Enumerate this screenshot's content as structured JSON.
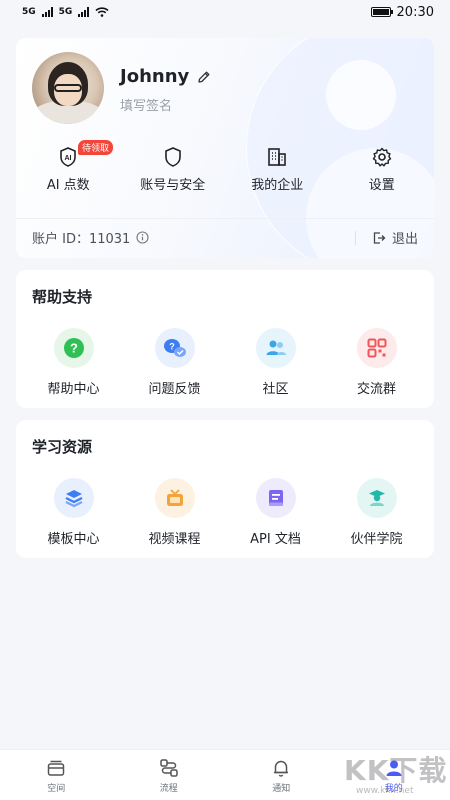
{
  "status": {
    "time": "20:30",
    "signal_left": "5G",
    "signal_right": "5G"
  },
  "profile": {
    "name": "Johnny",
    "signature_placeholder": "填写签名",
    "quick": [
      {
        "label": "AI 点数",
        "icon": "ai-shield-icon",
        "badge": "待领取"
      },
      {
        "label": "账号与安全",
        "icon": "shield-icon"
      },
      {
        "label": "我的企业",
        "icon": "building-icon"
      },
      {
        "label": "设置",
        "icon": "gear-icon"
      }
    ],
    "account_id": "账户 ID：11031",
    "logout": "退出"
  },
  "help": {
    "title": "帮助支持",
    "items": [
      {
        "label": "帮助中心",
        "icon": "question-icon",
        "color": "#2fbf54",
        "bg": "#e6f7ea"
      },
      {
        "label": "问题反馈",
        "icon": "feedback-icon",
        "color": "#3c7df4",
        "bg": "#e8f0fe"
      },
      {
        "label": "社区",
        "icon": "community-icon",
        "color": "#3aa6ea",
        "bg": "#e6f4fc"
      },
      {
        "label": "交流群",
        "icon": "qr-code-icon",
        "color": "#f0555a",
        "bg": "#fdeaea"
      }
    ]
  },
  "learn": {
    "title": "学习资源",
    "items": [
      {
        "label": "模板中心",
        "icon": "layers-icon",
        "color": "#3c7df4",
        "bg": "#e8f0fe"
      },
      {
        "label": "视频课程",
        "icon": "tv-icon",
        "color": "#f2a33a",
        "bg": "#fdf1e2"
      },
      {
        "label": "API 文档",
        "icon": "book-icon",
        "color": "#7b67f0",
        "bg": "#eeebfd"
      },
      {
        "label": "伙伴学院",
        "icon": "graduate-icon",
        "color": "#22b8a8",
        "bg": "#e4f6f3"
      }
    ]
  },
  "tabs": [
    {
      "label": "空间",
      "icon": "space-icon"
    },
    {
      "label": "流程",
      "icon": "flow-icon"
    },
    {
      "label": "通知",
      "icon": "bell-icon"
    },
    {
      "label": "我的",
      "icon": "user-icon",
      "active": true
    }
  ],
  "colors": {
    "accent": "#4a5cf5",
    "badge": "#f2463a"
  },
  "watermark": {
    "text": "KK下载",
    "url": "www.kkx.net"
  }
}
